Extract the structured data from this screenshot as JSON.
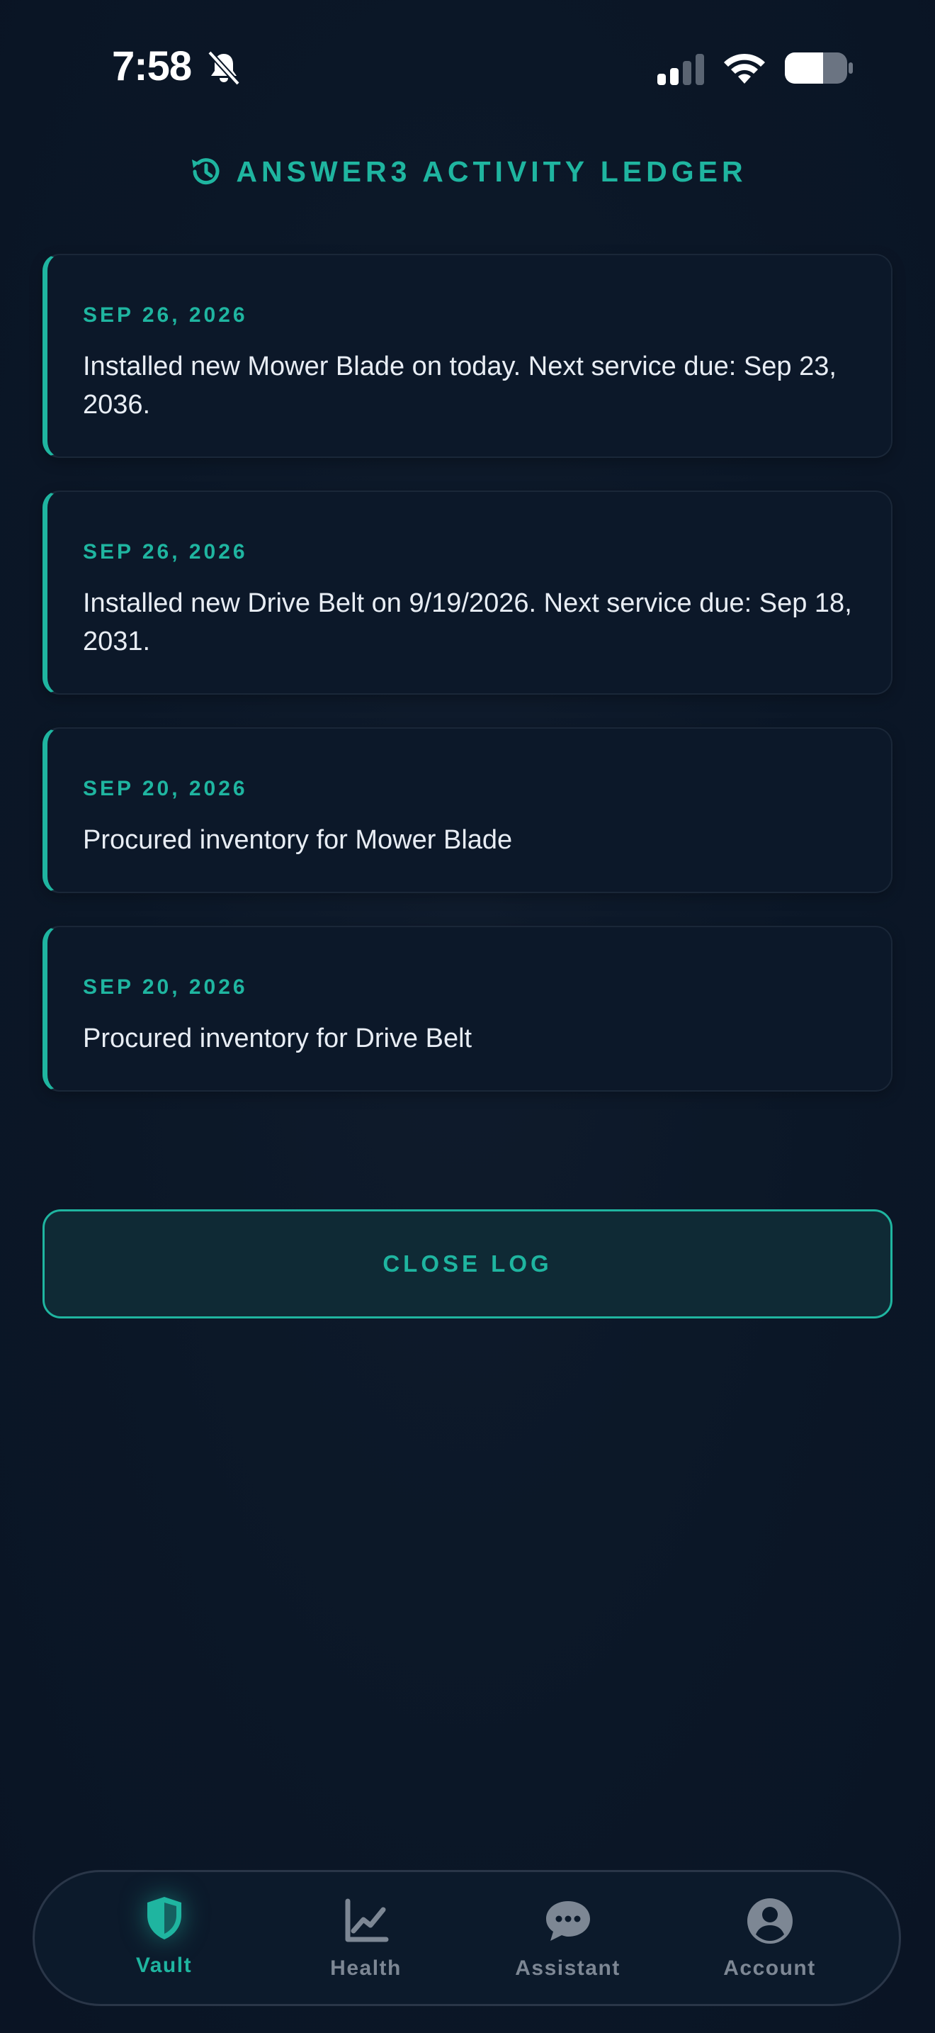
{
  "status_bar": {
    "time": "7:58"
  },
  "header": {
    "title": "ANSWER3 ACTIVITY LEDGER"
  },
  "log_entries": [
    {
      "date": "SEP 26, 2026",
      "text": "Installed new Mower Blade on today. Next service due: Sep 23, 2036."
    },
    {
      "date": "SEP 26, 2026",
      "text": "Installed new Drive Belt on 9/19/2026. Next service due: Sep 18, 2031."
    },
    {
      "date": "SEP 20, 2026",
      "text": "Procured inventory for Mower Blade"
    },
    {
      "date": "SEP 20, 2026",
      "text": "Procured inventory for Drive Belt"
    }
  ],
  "close_button": {
    "label": "CLOSE LOG"
  },
  "bottom_nav": {
    "items": [
      {
        "label": "Vault",
        "icon": "shield-icon",
        "active": true
      },
      {
        "label": "Health",
        "icon": "chart-icon",
        "active": false
      },
      {
        "label": "Assistant",
        "icon": "chat-icon",
        "active": false
      },
      {
        "label": "Account",
        "icon": "account-icon",
        "active": false
      }
    ]
  },
  "colors": {
    "accent": "#1fb5a0",
    "background": "#0b1727",
    "card": "#0c1829",
    "inactive": "#7d8794"
  }
}
